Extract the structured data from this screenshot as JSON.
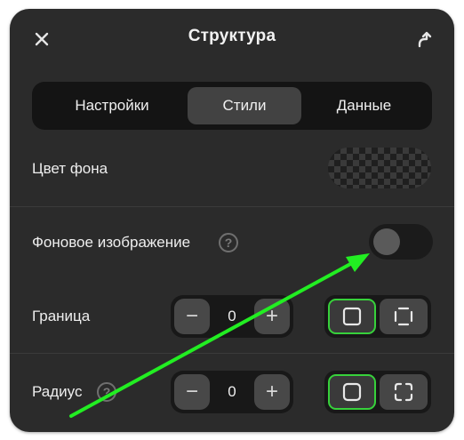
{
  "header": {
    "title": "Структура",
    "close_icon": "close-icon",
    "return_icon": "arrow-turn-up-icon"
  },
  "tabs": [
    {
      "label": "Настройки",
      "active": false
    },
    {
      "label": "Стили",
      "active": true
    },
    {
      "label": "Данные",
      "active": false
    }
  ],
  "background_color": {
    "label": "Цвет фона",
    "swatch": "transparent-checkerboard"
  },
  "background_image": {
    "label": "Фоновое изображение",
    "help_glyph": "?",
    "toggle_on": false
  },
  "border": {
    "label": "Граница",
    "minus": "−",
    "value": "0",
    "plus": "+",
    "mode_all_icon": "square-icon",
    "mode_sides_icon": "square-dashed-sides-icon",
    "selected_mode": "all"
  },
  "radius": {
    "label": "Радиус",
    "help_glyph": "?",
    "minus": "−",
    "value": "0",
    "plus": "+",
    "mode_all_icon": "rounded-square-icon",
    "mode_corners_icon": "corners-icon",
    "selected_mode": "all"
  },
  "colors": {
    "panel": "#2b2b2b",
    "accent_selection": "#37d13b",
    "annotation_arrow": "#22ee22"
  }
}
